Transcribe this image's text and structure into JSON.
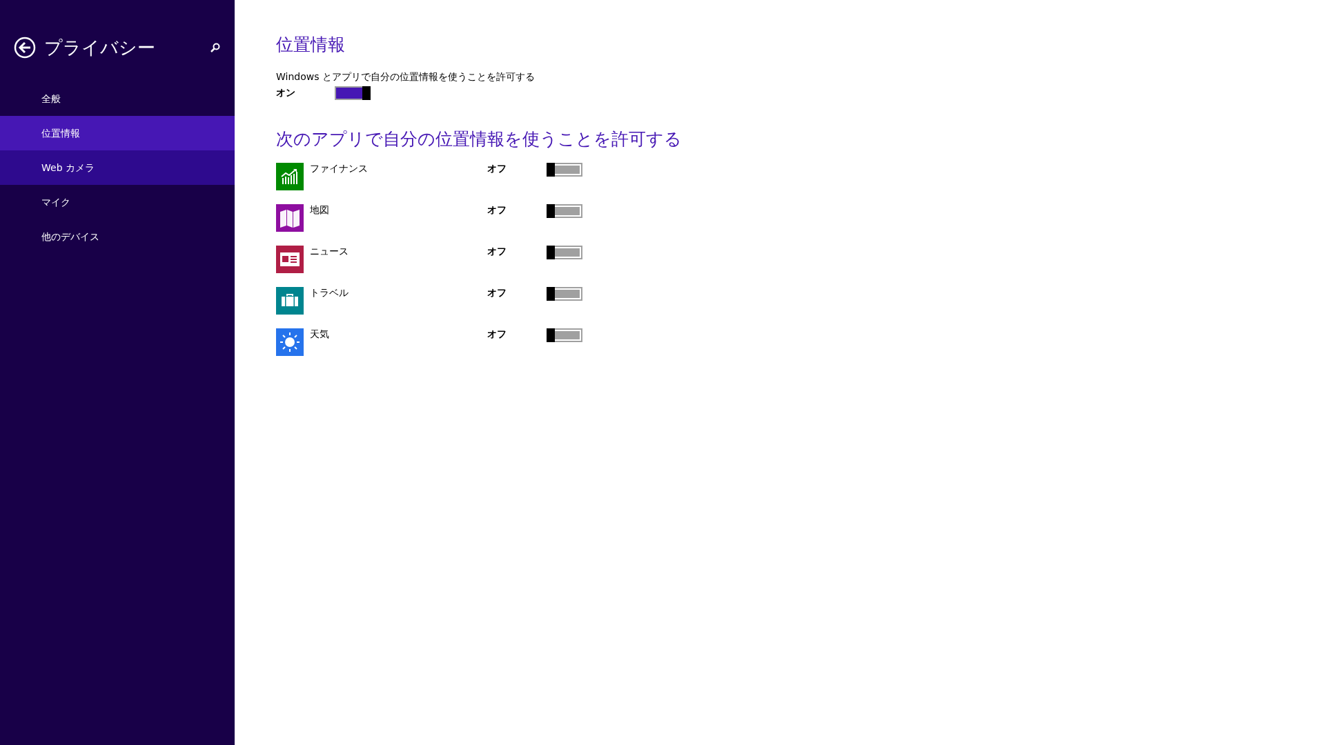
{
  "sidebar": {
    "title": "プライバシー",
    "items": [
      {
        "label": "全般",
        "selected": false,
        "hovered": false
      },
      {
        "label": "位置情報",
        "selected": true,
        "hovered": false
      },
      {
        "label": "Web カメラ",
        "selected": false,
        "hovered": true
      },
      {
        "label": "マイク",
        "selected": false,
        "hovered": false
      },
      {
        "label": "他のデバイス",
        "selected": false,
        "hovered": false
      }
    ]
  },
  "location": {
    "heading": "位置情報",
    "description": "Windows とアプリで自分の位置情報を使うことを許可する",
    "state_label": "オン",
    "on": true
  },
  "apps_section": {
    "heading": "次のアプリで自分の位置情報を使うことを許可する",
    "apps": [
      {
        "name": "ファイナンス",
        "kind": "finance",
        "color": "#008a00",
        "state_label": "オフ",
        "on": false
      },
      {
        "name": "地図",
        "kind": "maps",
        "color": "#8e0ea0",
        "state_label": "オフ",
        "on": false
      },
      {
        "name": "ニュース",
        "kind": "news",
        "color": "#b01e45",
        "state_label": "オフ",
        "on": false
      },
      {
        "name": "トラベル",
        "kind": "travel",
        "color": "#00858f",
        "state_label": "オフ",
        "on": false
      },
      {
        "name": "天気",
        "kind": "weather",
        "color": "#2673ec",
        "state_label": "オフ",
        "on": false
      }
    ]
  }
}
